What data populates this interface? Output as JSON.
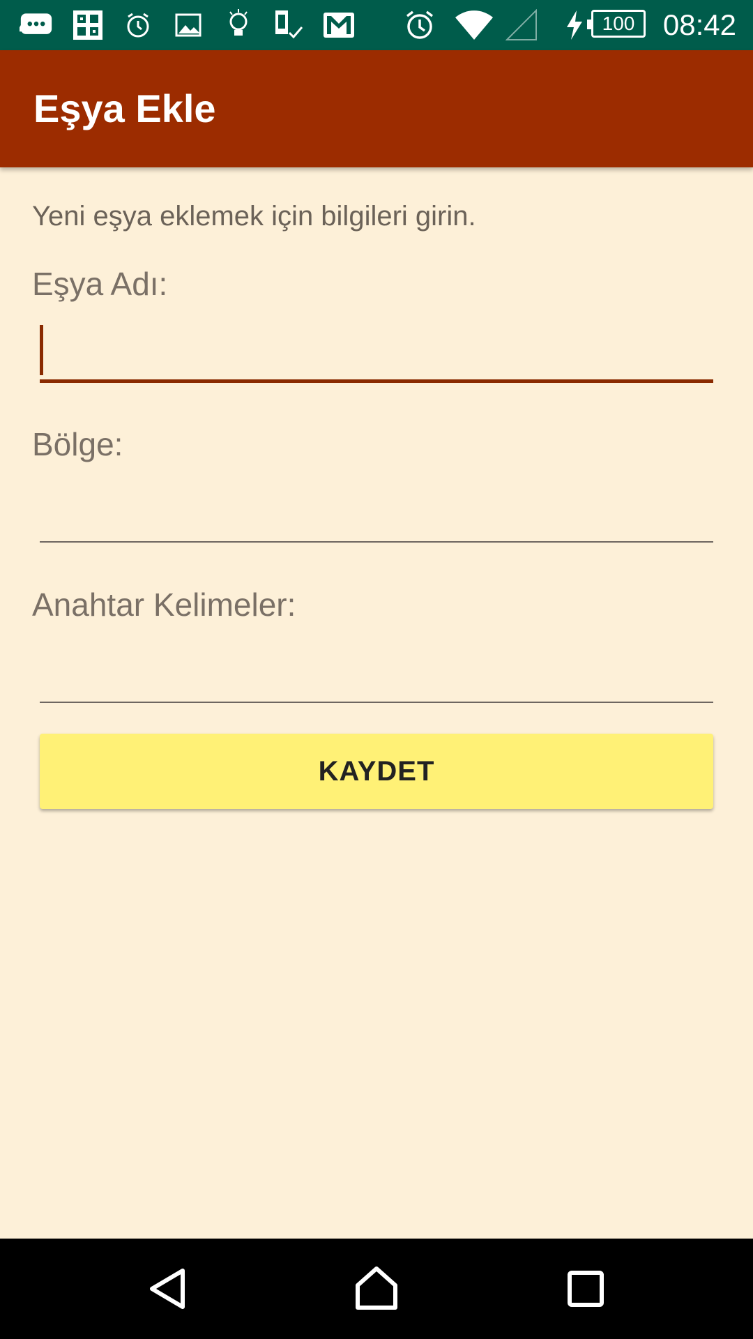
{
  "status_bar": {
    "time": "08:42",
    "battery": "100",
    "icons": [
      "chat-icon",
      "photo-grid-icon",
      "alarm-small-icon",
      "image-icon",
      "bulb-icon",
      "device-check-icon",
      "gmail-icon",
      "alarm-icon",
      "wifi-icon",
      "signal-icon",
      "charging-icon"
    ]
  },
  "app_bar": {
    "title": "Eşya Ekle"
  },
  "form": {
    "instructions": "Yeni eşya eklemek için bilgileri girin.",
    "item_name": {
      "label": "Eşya Adı:",
      "value": ""
    },
    "region": {
      "label": "Bölge:",
      "value": ""
    },
    "keywords": {
      "label": "Anahtar Kelimeler:",
      "value": ""
    },
    "save_label": "KAYDET"
  },
  "colors": {
    "status_bar": "#005c4b",
    "app_bar": "#9c2c00",
    "background": "#fdf0d8",
    "accent": "#8a2a00",
    "button": "#fff176"
  },
  "nav_bar": {
    "icons": [
      "back-icon",
      "home-icon",
      "recents-icon"
    ]
  }
}
